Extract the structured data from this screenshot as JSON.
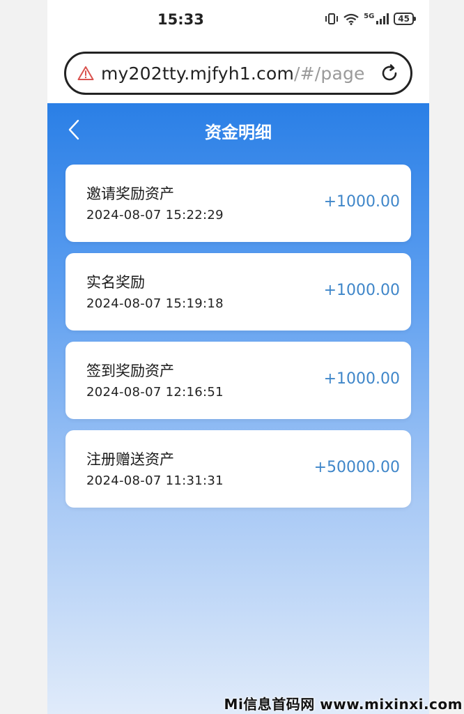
{
  "status_bar": {
    "time": "15:33",
    "network": "5G",
    "battery": "45"
  },
  "browser": {
    "url_main": "my202tty.mjfyh1.com",
    "url_faded": "/#/page"
  },
  "header": {
    "title": "资金明细"
  },
  "records": [
    {
      "title": "邀请奖励资产",
      "time": "2024-08-07 15:22:29",
      "amount": "+1000.00"
    },
    {
      "title": "实名奖励",
      "time": "2024-08-07 15:19:18",
      "amount": "+1000.00"
    },
    {
      "title": "签到奖励资产",
      "time": "2024-08-07 12:16:51",
      "amount": "+1000.00"
    },
    {
      "title": "注册赠送资产",
      "time": "2024-08-07 11:31:31",
      "amount": "+50000.00"
    }
  ],
  "watermark": "Mi信息首码网 www.mixinxi.com",
  "colors": {
    "header_blue": "#2a7fe6",
    "amount_blue": "#3f86c9",
    "warning_red": "#d9534f"
  },
  "icons": {
    "back": "chevron-left-icon",
    "warning": "warning-triangle-icon",
    "reload": "reload-icon"
  }
}
